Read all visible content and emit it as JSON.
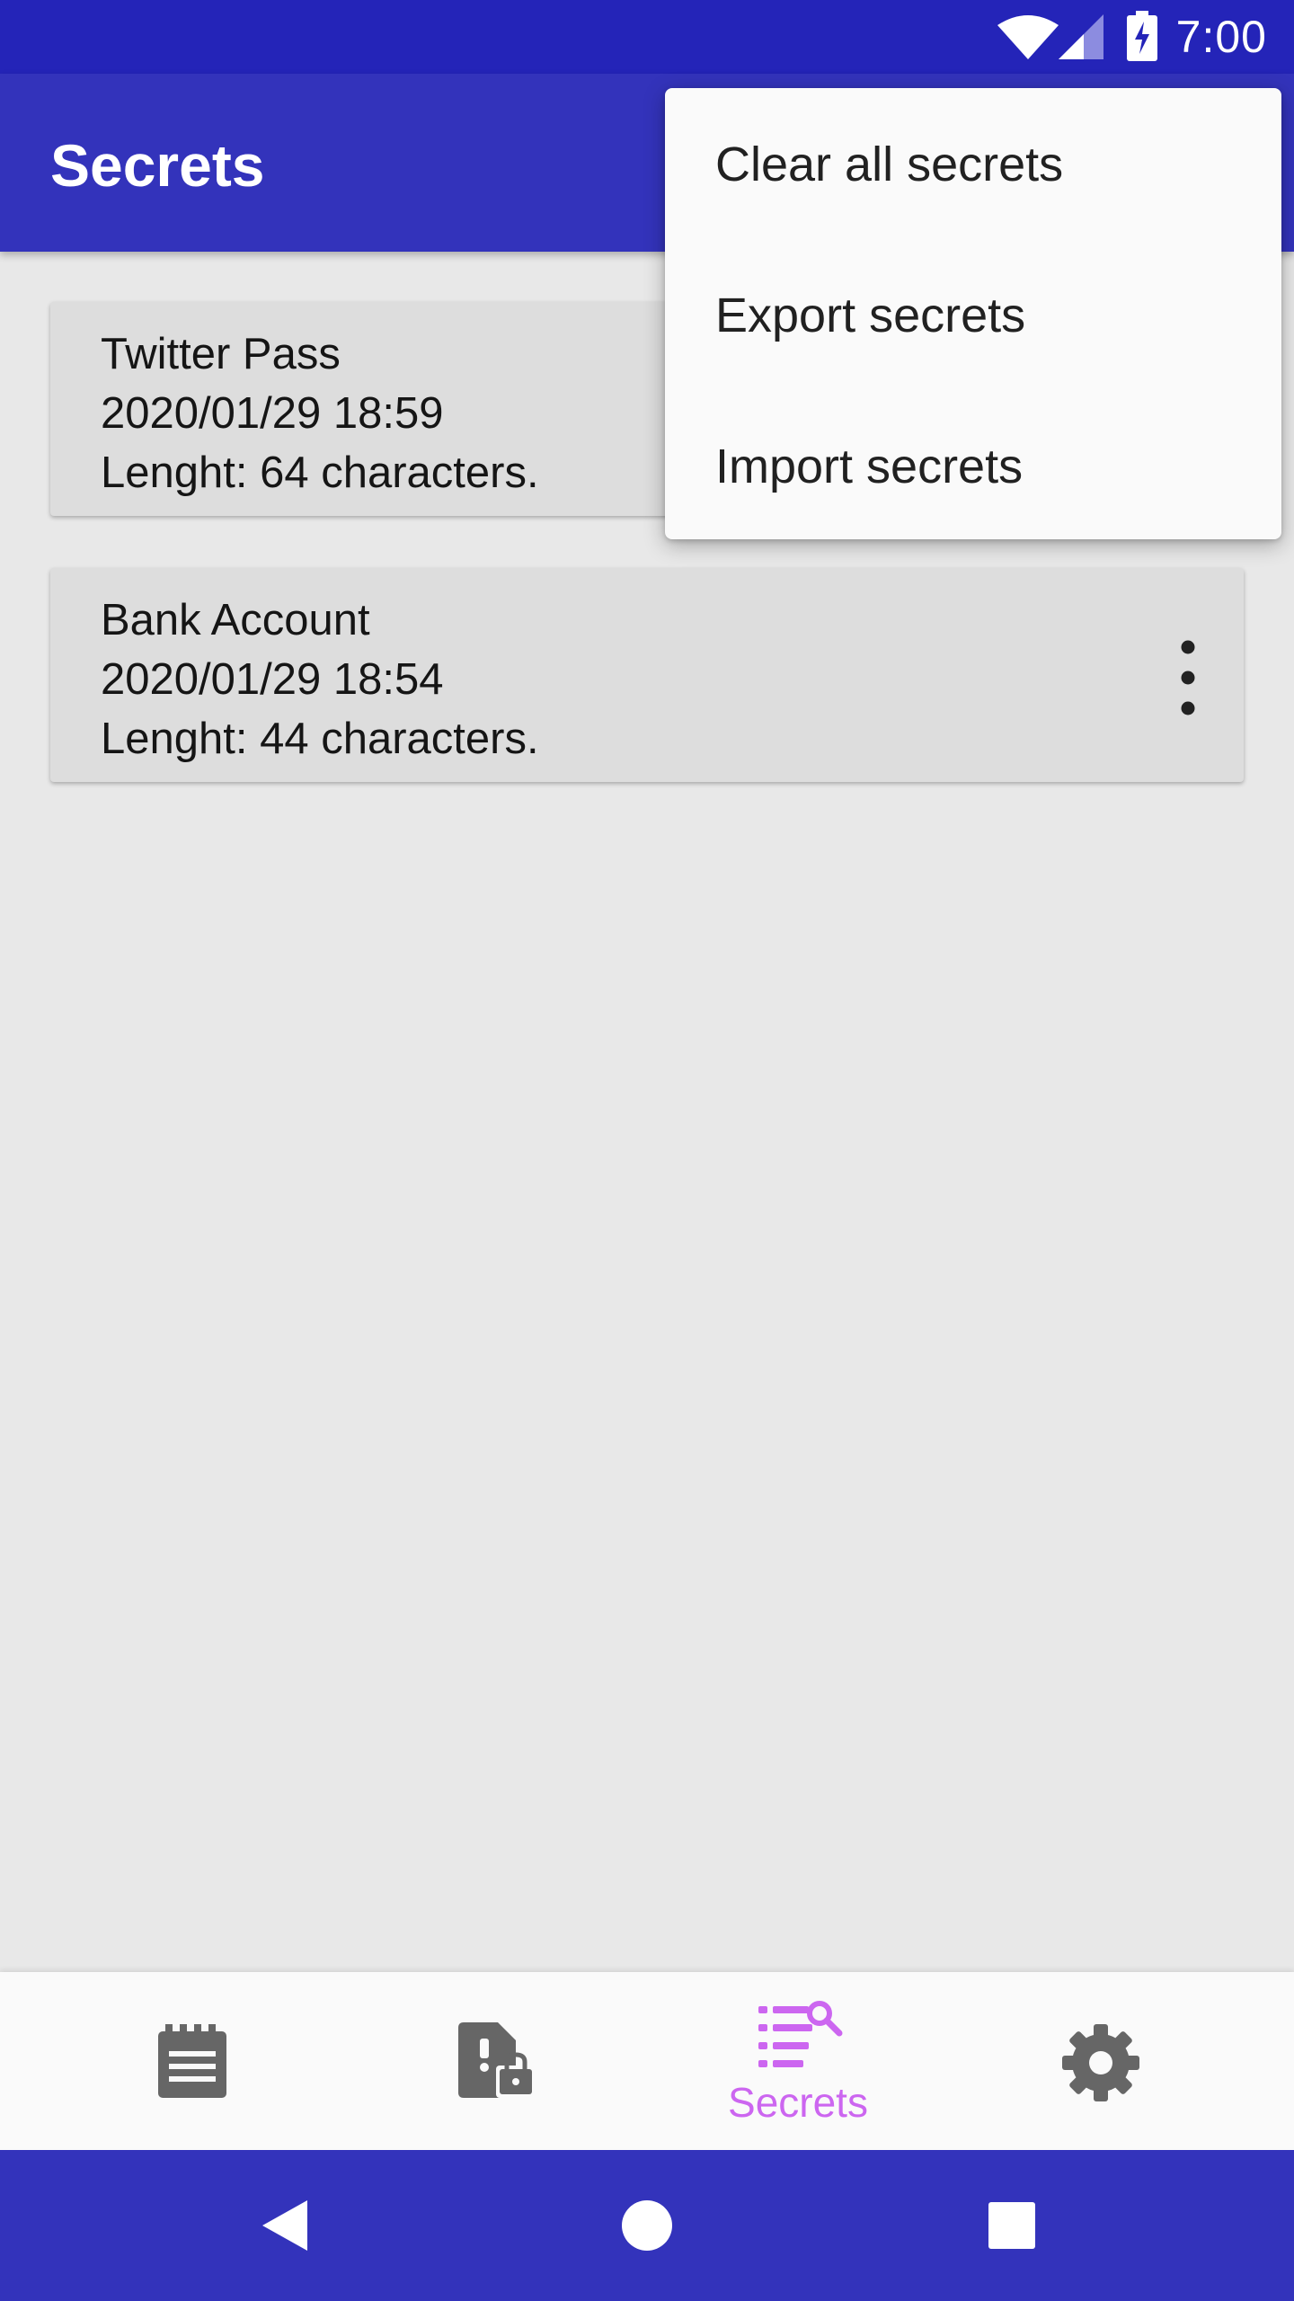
{
  "status_bar": {
    "time": "7:00",
    "icons": [
      "wifi-icon",
      "signal-icon",
      "battery-charging-icon"
    ]
  },
  "app_bar": {
    "title": "Secrets",
    "color": "#3333bb"
  },
  "secrets": [
    {
      "name": "Twitter Pass",
      "date": "2020/01/29 18:59",
      "length": "Lenght: 64 characters."
    },
    {
      "name": "Bank Account",
      "date": "2020/01/29 18:54",
      "length": "Lenght: 44 characters."
    }
  ],
  "overflow_menu": {
    "items": [
      {
        "label": "Clear all secrets"
      },
      {
        "label": "Export secrets"
      },
      {
        "label": "Import secrets"
      }
    ]
  },
  "bottom_nav": {
    "items": [
      {
        "icon": "notes-icon",
        "label": "",
        "selected": false
      },
      {
        "icon": "locked-file-icon",
        "label": "",
        "selected": false
      },
      {
        "icon": "secrets-list-search-icon",
        "label": "Secrets",
        "selected": true
      },
      {
        "icon": "gear-icon",
        "label": "",
        "selected": false
      }
    ],
    "active_color": "#cc66f0",
    "inactive_color": "#666666"
  },
  "system_nav": {
    "icons": [
      "back-icon",
      "home-icon",
      "recents-icon"
    ]
  }
}
